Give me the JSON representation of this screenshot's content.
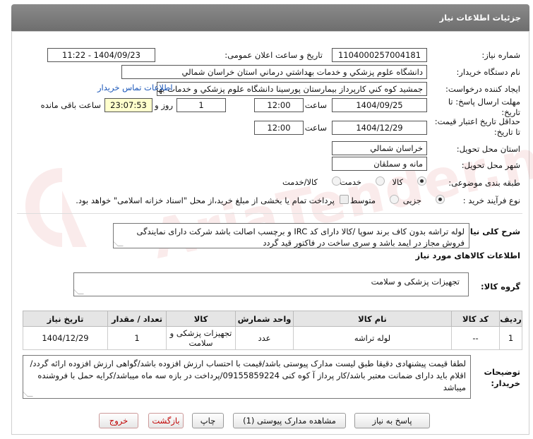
{
  "window": {
    "title": "جزئیات اطلاعات نیاز"
  },
  "fields": {
    "need_number_label": "شماره نیاز:",
    "need_number": "1104000257004181",
    "announce_label": "تاریخ و ساعت اعلان عمومی:",
    "announce_value": "1404/09/23 - 11:22",
    "buyer_org_label": "نام دستگاه خریدار:",
    "buyer_org": "دانشگاه علوم پزشکي و خدمات بهداشتي درماني استان خراسان شمالي",
    "requester_label": "ایجاد کننده درخواست:",
    "requester": "جمشيد کوه کني کارپرداز بیمارستان پورسينا دانشگاه علوم پزشکي و خدمات بهد",
    "contact_link": "اطلاعات تماس خریدار",
    "reply_deadline_label": "مهلت ارسال پاسخ: تا تاریخ:",
    "reply_date": "1404/09/25",
    "time_label": "ساعت",
    "reply_time": "12:00",
    "days_value": "1",
    "days_label": "روز و",
    "remaining_time": "23:07:53",
    "remaining_label": "ساعت باقی مانده",
    "validity_label": "حداقل تاریخ اعتبار قیمت: تا تاریخ:",
    "validity_date": "1404/12/29",
    "validity_time": "12:00",
    "province_label": "استان محل تحویل:",
    "province": "خراسان شمالي",
    "city_label": "شهر محل تحویل:",
    "city": "مانه و سملقان",
    "category_label": "طبقه بندی موضوعی:",
    "cat_options": [
      "کالا",
      "خدمت",
      "کالا/خدمت"
    ],
    "process_label": "نوع فرآیند خرید :",
    "proc_options": [
      "جزیی",
      "متوسط"
    ],
    "payment_note": "پرداخت تمام یا بخشی از مبلغ خرید،از محل \"اسناد خزانه اسلامی\" خواهد بود."
  },
  "description": {
    "label": "شرح کلی نیاز:",
    "text": "لوله تراشه بدون کاف برند سوپا /کالا دارای کد IRC و برچسب اصالت باشد شرکت دارای نمایندگی فروش مجاز در ایمد باشد و سری ساخت در فاکتور قید گردد"
  },
  "goods": {
    "section_title": "اطلاعات کالاهای مورد نیاز",
    "group_label": "گروه کالا:",
    "group_value": "تجهیزات پزشکی و سلامت",
    "table_headers": [
      "ردیف",
      "کد کالا",
      "نام کالا",
      "واحد شمارش",
      "کالا",
      "تعداد / مقدار",
      "تاریخ نیاز"
    ],
    "rows": [
      {
        "row": "1",
        "code": "--",
        "name": "لوله تراشه",
        "unit": "عدد",
        "category": "تجهیزات پزشکی و سلامت",
        "qty": "1",
        "date": "1404/12/29"
      }
    ]
  },
  "buyer_notes": {
    "label": "توضیحات خریدار:",
    "text": "لطفا قیمت پیشنهادی دقیقا طبق لیست مدارک پیوستی باشد/قیمت با احتساب ارزش افزوده باشد/گواهی ارزش افزوده ارائه گردد/اقلام باید دارای ضمانت معتبر باشد/کار پرداز آ کوه کنی 09155859224/پرداخت در بازه سه ماه میباشد/کرایه حمل با فروشنده میباشد"
  },
  "buttons": {
    "reply": "پاسخ به نیاز",
    "attachments": "مشاهده مدارک پیوستی (1)",
    "print": "چاپ",
    "back": "بازگشت",
    "exit": "خروج"
  },
  "watermark": "AriaTender.net"
}
